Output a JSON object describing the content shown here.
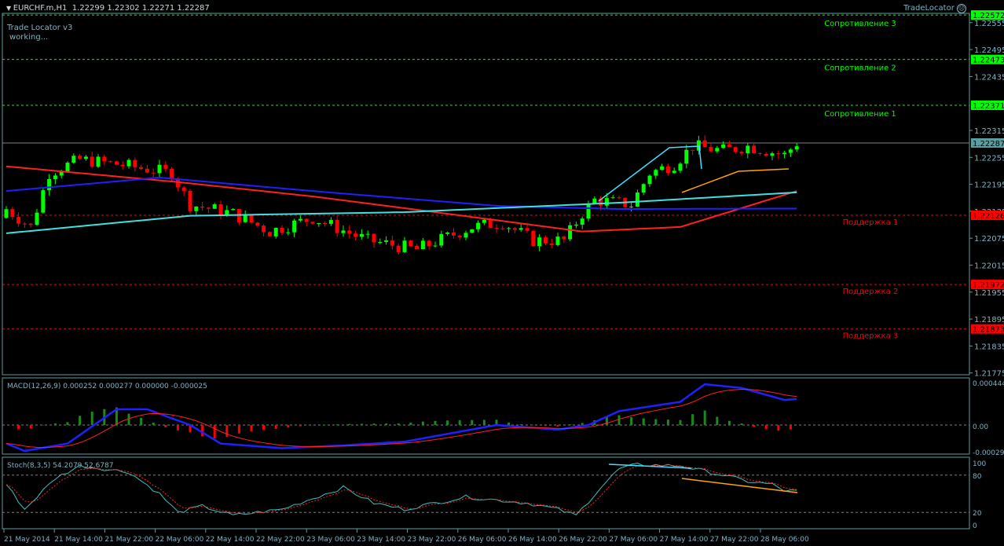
{
  "header": {
    "symbol": "EURCHF.m,H1",
    "ohlc": "1.22299 1.22302 1.22271 1.22287"
  },
  "indicator": {
    "name": "Trade Locator v3",
    "status": "working...",
    "brand": "TradeLocator",
    "icon": "frown-face-icon"
  },
  "price_axis": {
    "ticks": [
      "1.22555",
      "1.22495",
      "1.22435",
      "1.22315",
      "1.22255",
      "1.22195",
      "1.22135",
      "1.22075",
      "1.22015",
      "1.21955",
      "1.21895",
      "1.21835",
      "1.21775"
    ],
    "current": "1.22287"
  },
  "levels": [
    {
      "label": "Сопротивление 3",
      "price": "1.22572",
      "color": "#00ff00"
    },
    {
      "label": "Сопротивление 2",
      "price": "1.22473",
      "color": "#00ff00"
    },
    {
      "label": "Сопротивление 1",
      "price": "1.22371",
      "color": "#00ff00"
    },
    {
      "label": "Поддержка 1",
      "price": "1.22126",
      "color": "#ff0000"
    },
    {
      "label": "Поддержка 2",
      "price": "1.21972",
      "color": "#ff0000"
    },
    {
      "label": "Поддержка 3",
      "price": "1.21873",
      "color": "#ff0000"
    }
  ],
  "macd": {
    "title": "MACD(12,26,9) 0.000252 0.000277 0.000000 -0.000025",
    "ticks": [
      "0.000444",
      "0.00",
      "-0.000295"
    ]
  },
  "stoch": {
    "title": "Stoch(8,3,5) 54.2079 52.6787",
    "ticks": [
      "100",
      "80",
      "20",
      "0"
    ]
  },
  "time_axis": [
    "21 May 2014",
    "21 May 14:00",
    "21 May 22:00",
    "22 May 06:00",
    "22 May 14:00",
    "22 May 22:00",
    "23 May 06:00",
    "23 May 14:00",
    "23 May 22:00",
    "26 May 06:00",
    "26 May 14:00",
    "26 May 22:00",
    "27 May 06:00",
    "27 May 14:00",
    "27 May 22:00",
    "28 May 06:00"
  ],
  "chart_data": {
    "type": "candlestick",
    "candles": 130,
    "close_path": [
      [
        0,
        1.2214
      ],
      [
        4,
        1.221
      ],
      [
        7,
        1.2222
      ],
      [
        12,
        1.2225
      ],
      [
        18,
        1.2224
      ],
      [
        27,
        1.2222
      ],
      [
        30,
        1.2215
      ],
      [
        37,
        1.2213
      ],
      [
        43,
        1.2209
      ],
      [
        50,
        1.2212
      ],
      [
        59,
        1.2207
      ],
      [
        67,
        1.2205
      ],
      [
        76,
        1.221
      ],
      [
        81,
        1.2211
      ],
      [
        86,
        1.2207
      ],
      [
        91,
        1.2207
      ],
      [
        94,
        1.2213
      ],
      [
        96,
        1.2216
      ],
      [
        102,
        1.2215
      ],
      [
        105,
        1.2222
      ],
      [
        109,
        1.2224
      ],
      [
        112,
        1.2228
      ],
      [
        117,
        1.2227
      ],
      [
        121,
        1.2228
      ],
      [
        127,
        1.2226
      ],
      [
        129,
        1.22287
      ]
    ],
    "ma_red": [
      [
        0,
        1.22235
      ],
      [
        28,
        1.222
      ],
      [
        50,
        1.22168
      ],
      [
        70,
        1.22133
      ],
      [
        94,
        1.2209
      ],
      [
        110,
        1.221
      ],
      [
        129,
        1.2218
      ]
    ],
    "ma_blue": [
      [
        0,
        1.2218
      ],
      [
        25,
        1.2221
      ],
      [
        50,
        1.2218
      ],
      [
        80,
        1.22147
      ],
      [
        100,
        1.2214
      ],
      [
        129,
        1.22141
      ]
    ],
    "ma_cyan": [
      [
        0,
        1.22086
      ],
      [
        30,
        1.22125
      ],
      [
        65,
        1.22133
      ],
      [
        100,
        1.22154
      ],
      [
        129,
        1.22177
      ]
    ],
    "macd": [
      [
        0,
        -0.0002
      ],
      [
        3,
        -0.00028
      ],
      [
        10,
        -0.0002
      ],
      [
        18,
        0.00017
      ],
      [
        23,
        0.00017
      ],
      [
        30,
        0
      ],
      [
        35,
        -0.0002
      ],
      [
        45,
        -0.00025
      ],
      [
        55,
        -0.00022
      ],
      [
        65,
        -0.00018
      ],
      [
        80,
        0
      ],
      [
        90,
        -5e-05
      ],
      [
        95,
        0
      ],
      [
        100,
        0.00015
      ],
      [
        110,
        0.00025
      ],
      [
        114,
        0.00044
      ],
      [
        120,
        0.0004
      ],
      [
        127,
        0.00027
      ],
      [
        129,
        0.00028
      ]
    ],
    "stoch": [
      [
        0,
        65
      ],
      [
        3,
        25
      ],
      [
        8,
        75
      ],
      [
        12,
        95
      ],
      [
        20,
        85
      ],
      [
        25,
        50
      ],
      [
        28,
        20
      ],
      [
        32,
        30
      ],
      [
        37,
        15
      ],
      [
        45,
        25
      ],
      [
        55,
        60
      ],
      [
        60,
        35
      ],
      [
        65,
        25
      ],
      [
        75,
        45
      ],
      [
        85,
        35
      ],
      [
        90,
        25
      ],
      [
        93,
        15
      ],
      [
        97,
        60
      ],
      [
        100,
        90
      ],
      [
        103,
        97
      ],
      [
        110,
        95
      ],
      [
        117,
        80
      ],
      [
        121,
        70
      ],
      [
        125,
        65
      ],
      [
        127,
        55
      ],
      [
        129,
        54
      ]
    ],
    "price_range": [
      1.2174,
      1.22582
    ]
  }
}
